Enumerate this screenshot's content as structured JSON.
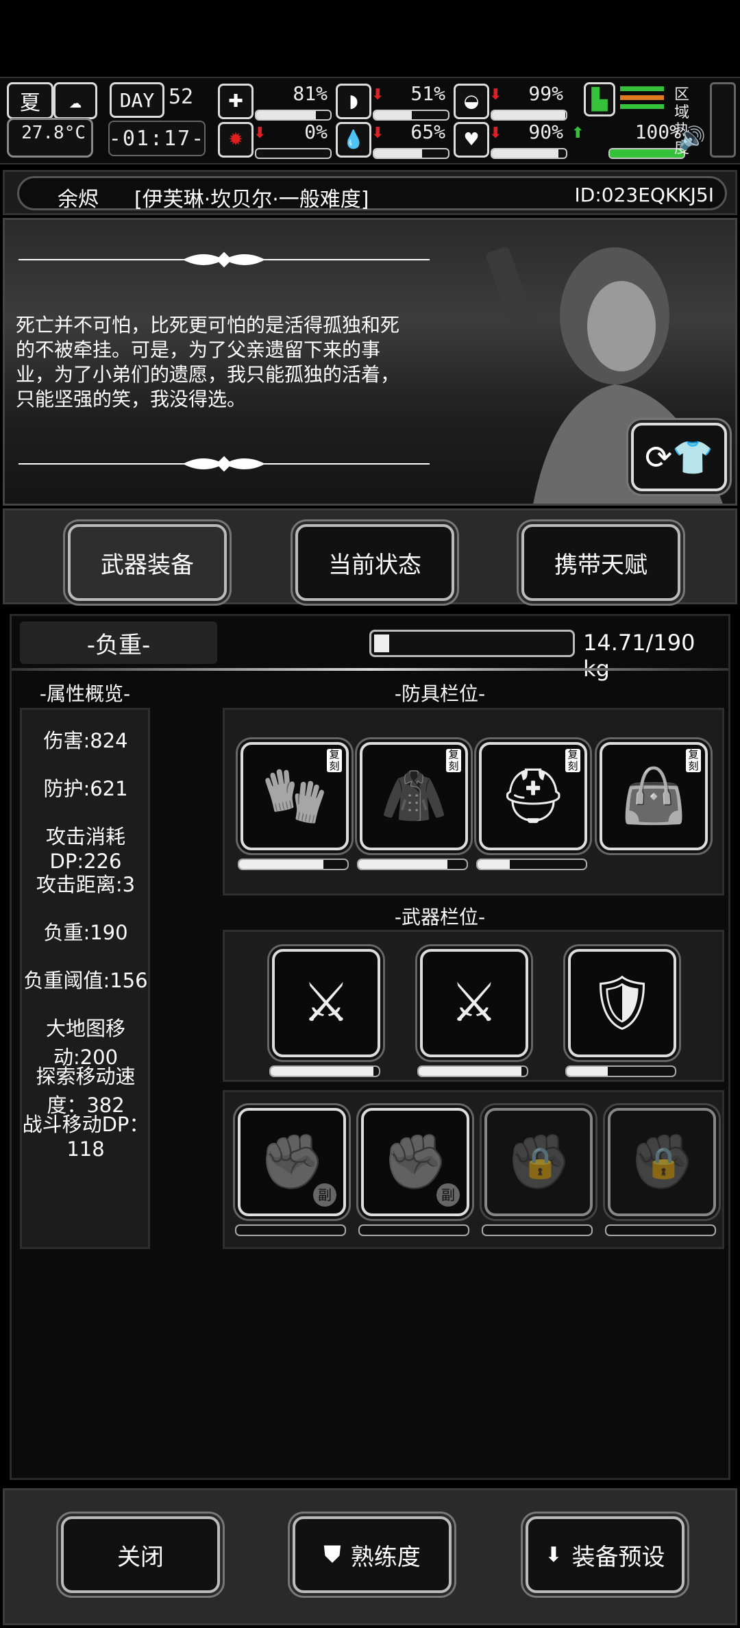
{
  "hud": {
    "season": "夏",
    "day_label": "DAY",
    "day": "52",
    "temperature": "27.8°C",
    "time": "-01:17-",
    "region_heat_label": "区域热度",
    "stats": [
      {
        "name": "health",
        "value": "81%",
        "level": 0.81,
        "trend": "none"
      },
      {
        "name": "satiety",
        "value": "51%",
        "level": 0.51,
        "trend": "down"
      },
      {
        "name": "mood",
        "value": "99%",
        "level": 0.99,
        "trend": "down"
      },
      {
        "name": "stamina",
        "value": "",
        "level": 1.0,
        "trend": "none"
      },
      {
        "name": "infection",
        "value": "0%",
        "level": 0.0,
        "trend": "down"
      },
      {
        "name": "water",
        "value": "65%",
        "level": 0.65,
        "trend": "down"
      },
      {
        "name": "heart",
        "value": "90%",
        "level": 0.9,
        "trend": "down"
      },
      {
        "name": "energy",
        "value": "100%",
        "level": 1.0,
        "trend": "up"
      }
    ]
  },
  "character": {
    "name": "[伊芙琳·坎贝尔·一般难度]",
    "prefix": "余烬",
    "id": "ID:023EQKKJ5I",
    "quote": "死亡并不可怕，比死更可怕的是活得孤独和死的不被牵挂。可是，为了父亲遗留下来的事业，为了小弟们的遗愿，我只能孤独的活着，只能坚强的笑，我没得选。"
  },
  "tabs": [
    "武器装备",
    "当前状态",
    "携带天赋"
  ],
  "weight": {
    "label": "-负重-",
    "value_text": "14.71/190 kg",
    "fill": 0.077
  },
  "attributes": {
    "title": "-属性概览-",
    "items": [
      "伤害:824",
      "防护:621",
      "攻击消耗DP:226",
      "攻击距离:3",
      "负重:190",
      "负重阈值:156",
      "大地图移动:200",
      "探索移动速度：382",
      "战斗移动DP：118"
    ]
  },
  "armor": {
    "title": "-防具栏位-",
    "slots": [
      {
        "icon": "gloves-icon",
        "badge": "复刻",
        "durability": 0.78
      },
      {
        "icon": "cloak-icon",
        "badge": "复刻",
        "durability": 0.82
      },
      {
        "icon": "helmet-icon",
        "badge": "复刻",
        "durability": 0.3
      },
      {
        "icon": "bag-icon",
        "badge": "复刻",
        "durability": null
      }
    ]
  },
  "weapons": {
    "title": "-武器栏位-",
    "slots": [
      {
        "icon": "katana-icon",
        "durability": 0.95
      },
      {
        "icon": "katana-icon",
        "durability": 0.95
      },
      {
        "icon": "riot-shield-icon",
        "durability": 0.38
      }
    ]
  },
  "sub_slots": [
    {
      "icon": "fist-icon",
      "badge": "副",
      "locked": false
    },
    {
      "icon": "fist-icon",
      "badge": "副",
      "locked": false
    },
    {
      "icon": "fist-icon",
      "badge": "",
      "locked": true
    },
    {
      "icon": "fist-icon",
      "badge": "",
      "locked": true
    }
  ],
  "footer": {
    "close": "关闭",
    "proficiency": "熟练度",
    "preset": "装备预设"
  },
  "colors": {
    "down": "#e02020",
    "up": "#35c13a",
    "accent": "#ffffff"
  }
}
